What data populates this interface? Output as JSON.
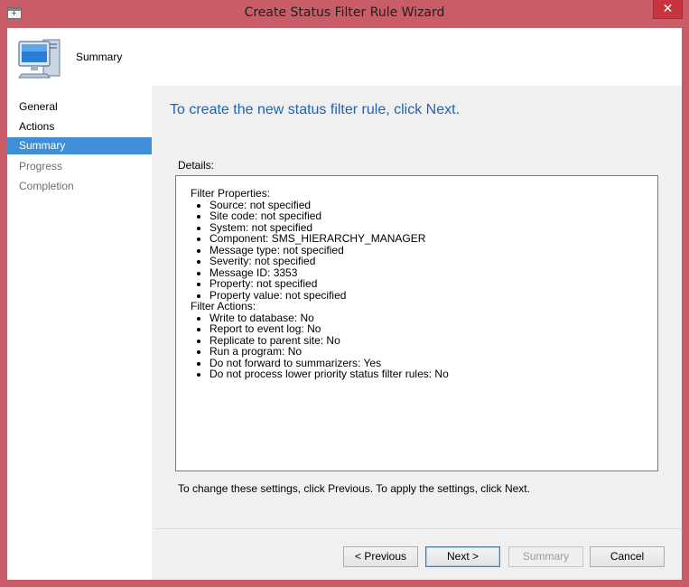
{
  "window": {
    "title": "Create Status Filter Rule Wizard",
    "close_glyph": "✕"
  },
  "header": {
    "title": "Summary",
    "icon": "computer-icon"
  },
  "nav": {
    "items": [
      {
        "label": "General",
        "state": "done"
      },
      {
        "label": "Actions",
        "state": "done"
      },
      {
        "label": "Summary",
        "state": "active"
      },
      {
        "label": "Progress",
        "state": "disabled"
      },
      {
        "label": "Completion",
        "state": "disabled"
      }
    ]
  },
  "main": {
    "heading": "To create the new status filter rule, click Next.",
    "details_label": "Details:",
    "details": {
      "filter_properties_title": "Filter Properties:",
      "filter_properties": [
        "Source: not specified",
        "Site code: not specified",
        "System: not specified",
        "Component: SMS_HIERARCHY_MANAGER",
        "Message type: not specified",
        "Severity: not specified",
        "Message ID: 3353",
        "Property: not specified",
        "Property value: not specified"
      ],
      "filter_actions_title": "Filter Actions:",
      "filter_actions": [
        "Write to database: No",
        "Report to event log: No",
        "Replicate to parent site: No",
        "Run a program: No",
        "Do not forward to summarizers: Yes",
        "Do not process lower priority status filter rules: No"
      ]
    },
    "hint": "To change these settings, click Previous. To apply the settings, click Next."
  },
  "buttons": {
    "previous": "< Previous",
    "next": "Next >",
    "summary": "Summary",
    "cancel": "Cancel"
  },
  "colors": {
    "frame": "#c95d67",
    "close": "#c7343f",
    "accent": "#3f8fd8",
    "heading": "#1c64b4"
  }
}
